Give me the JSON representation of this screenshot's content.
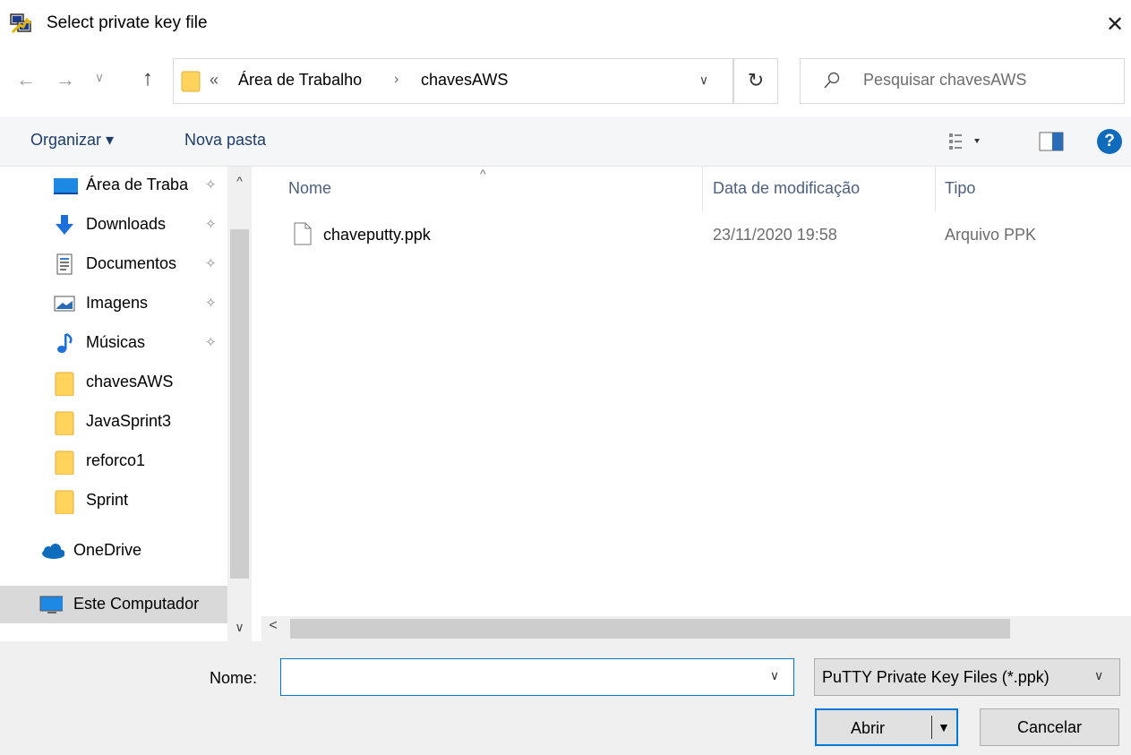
{
  "window": {
    "title": "Select private key file",
    "close_glyph": "✕"
  },
  "nav": {
    "back_glyph": "←",
    "forward_glyph": "→",
    "recent_glyph": "∨",
    "up_glyph": "↑"
  },
  "address": {
    "overflow_glyph": "«",
    "crumbs": [
      "Área de Trabalho",
      "chavesAWS"
    ],
    "separator_glyph": "›",
    "dropdown_glyph": "∨",
    "refresh_glyph": "↻"
  },
  "search": {
    "placeholder": "Pesquisar chavesAWS"
  },
  "toolbar": {
    "organize_label": "Organizar ▾",
    "new_folder_label": "Nova pasta",
    "help_glyph": "?"
  },
  "sidebar": {
    "pin_glyph": "📌",
    "scroll_up_glyph": "^",
    "scroll_down_glyph": "∨",
    "items": [
      {
        "label": "Área de Traba",
        "icon": "desktop-icon",
        "pinned": true
      },
      {
        "label": "Downloads",
        "icon": "download-icon",
        "pinned": true
      },
      {
        "label": "Documentos",
        "icon": "documents-icon",
        "pinned": true
      },
      {
        "label": "Imagens",
        "icon": "pictures-icon",
        "pinned": true
      },
      {
        "label": "Músicas",
        "icon": "music-icon",
        "pinned": true
      },
      {
        "label": "chavesAWS",
        "icon": "folder-icon",
        "pinned": false
      },
      {
        "label": "JavaSprint3",
        "icon": "folder-icon",
        "pinned": false
      },
      {
        "label": "reforco1",
        "icon": "folder-icon",
        "pinned": false
      },
      {
        "label": "Sprint",
        "icon": "folder-icon",
        "pinned": false
      },
      {
        "label": "OneDrive",
        "icon": "cloud-icon",
        "pinned": false
      },
      {
        "label": "Este Computador",
        "icon": "computer-icon",
        "pinned": false,
        "selected": true
      }
    ]
  },
  "filelist": {
    "sort_glyph": "^",
    "columns": [
      "Nome",
      "Data de modificação",
      "Tipo"
    ],
    "rows": [
      {
        "name": "chaveputty.ppk",
        "date": "23/11/2020 19:58",
        "type": "Arquivo PPK"
      }
    ],
    "hscroll_left_glyph": "<"
  },
  "footer": {
    "filename_label": "Nome:",
    "filename_value": "",
    "filename_dropdown_glyph": "∨",
    "filetype": "PuTTY Private Key Files (*.ppk)",
    "filetype_arrow": "∨",
    "open_label": "Abrir",
    "cancel_label": "Cancelar"
  },
  "colors": {
    "accent": "#0078d7",
    "folder_yellow": "#ffd35c",
    "selected_bg": "#d9d9d9"
  }
}
